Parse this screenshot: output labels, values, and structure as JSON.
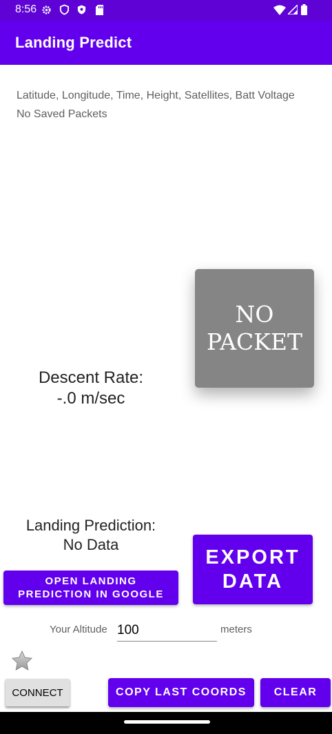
{
  "status_bar": {
    "time": "8:56",
    "left_icons": [
      "gear-icon",
      "shield-icon",
      "shield-check-icon",
      "sd-card-icon"
    ],
    "right_icons": [
      "wifi-icon",
      "signal-icon",
      "battery-icon"
    ]
  },
  "app_bar": {
    "title": "Landing Predict",
    "color": "#6200ee"
  },
  "content": {
    "header_line": "Latitude, Longitude, Time, Height, Satellites, Batt Voltage",
    "saved_packets": "No Saved Packets",
    "descent_label": "Descent Rate:",
    "descent_value": "-.0 m/sec",
    "packet_status_line1": "NO",
    "packet_status_line2": "PACKET",
    "landing_label": "Landing Prediction:",
    "landing_value": "No Data"
  },
  "buttons": {
    "export_line1": "EXPORT",
    "export_line2": "DATA",
    "open_google_line1": "OPEN LANDING",
    "open_google_line2": "PREDICTION IN GOOGLE",
    "connect": "CONNECT",
    "copy_last": "COPY LAST COORDS",
    "clear": "CLEAR"
  },
  "altitude": {
    "label": "Your Altitude",
    "value": "100",
    "unit": "meters"
  },
  "favorite": {
    "icon": "star-icon"
  }
}
